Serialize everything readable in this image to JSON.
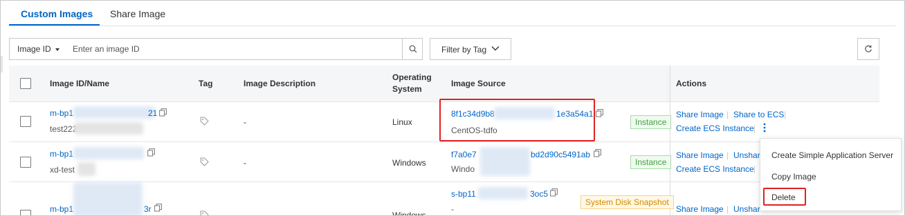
{
  "tabs": [
    {
      "label": "Custom Images",
      "active": true
    },
    {
      "label": "Share Image",
      "active": false
    }
  ],
  "toolbar": {
    "search_type": "Image ID",
    "search_placeholder": "Enter an image ID",
    "filter_label": "Filter by Tag"
  },
  "table": {
    "headers": {
      "image_id": "Image ID/Name",
      "tag": "Tag",
      "description": "Image Description",
      "os_line1": "Operating",
      "os_line2": "System",
      "source": "Image Source",
      "actions": "Actions"
    },
    "rows": [
      {
        "id_start": "m-bp1",
        "id_end": "21",
        "name": "test222",
        "description": "-",
        "os": "Linux",
        "source_id_start": "8f1c34d9b8",
        "source_id_end": "1e3a54a1",
        "source_name": "CentOS-tdfo",
        "source_badge": "Instance",
        "actions": [
          "Share Image",
          "Share to ECS",
          "Create ECS Instance"
        ]
      },
      {
        "id_start": "m-bp1",
        "name": "xd-test",
        "description": "-",
        "os": "Windows",
        "source_id_start": "f7a0e7",
        "source_id_end": "bd2d90c5491ab",
        "source_name": "Windo",
        "source_badge": "Instance",
        "actions": [
          "Share Image",
          "Unshar",
          "Create ECS Instance"
        ]
      },
      {
        "id_start": "m-bp1",
        "id_end": "3r",
        "description": "",
        "os": "Windows",
        "source_id_start": "s-bp11",
        "source_id_end": "3oc5",
        "source_name": "-",
        "source_badge": "System Disk Snapshot",
        "actions": [
          "Share Image",
          "Unshar"
        ]
      }
    ]
  },
  "menu": {
    "items": [
      "Create Simple Application Server",
      "Copy Image",
      "Delete"
    ]
  },
  "colors": {
    "accent": "#0064c8",
    "highlight": "#e02020",
    "badge_green": "#3fa33f",
    "badge_yellow": "#d18a00"
  }
}
